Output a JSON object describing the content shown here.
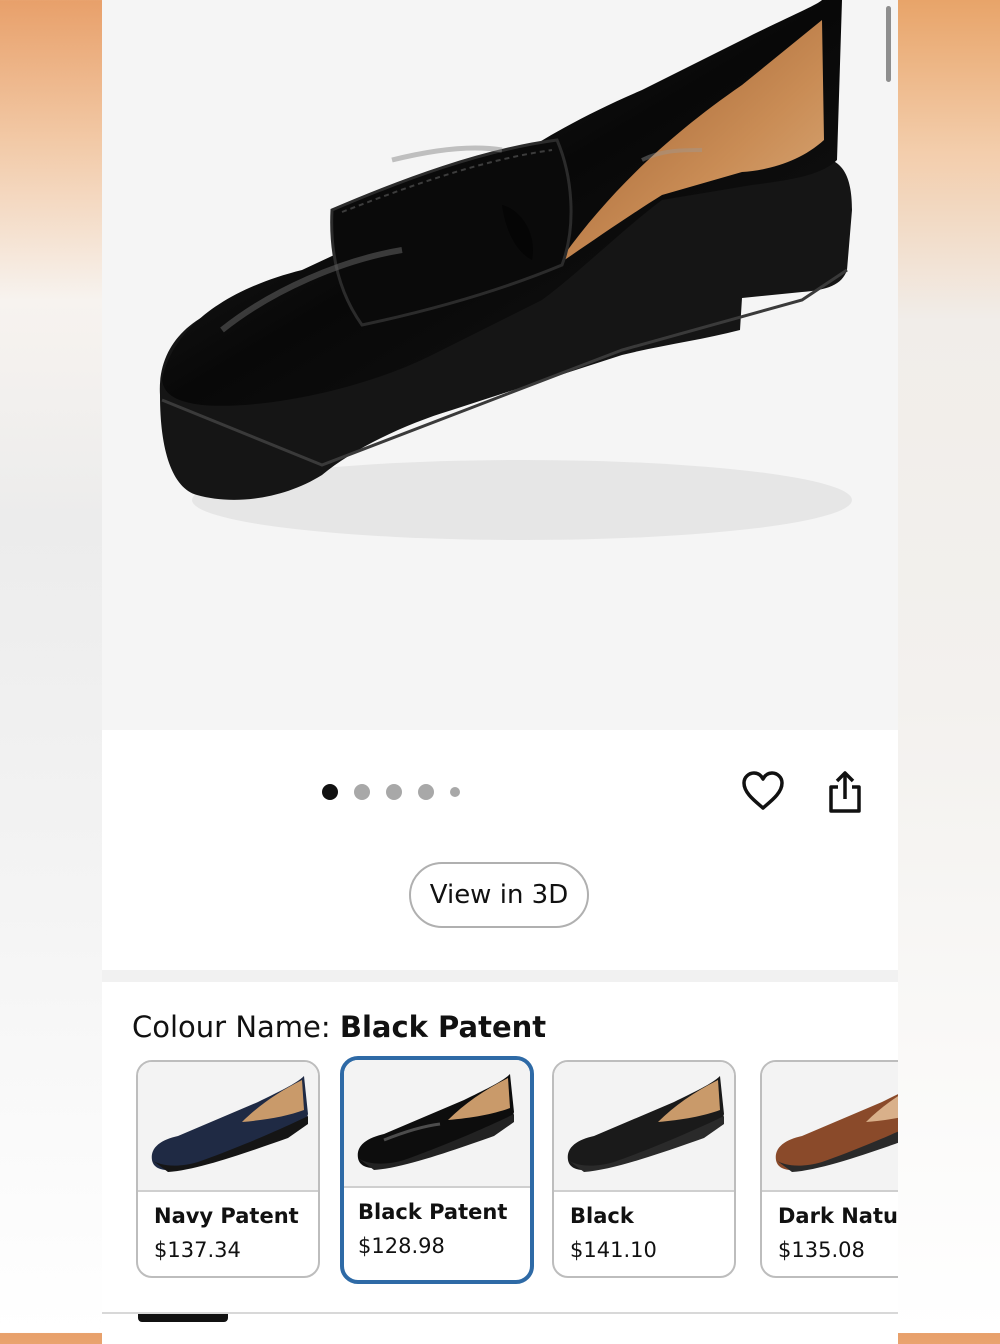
{
  "gallery": {
    "image_alt": "Black patent loafer",
    "dot_count": 5,
    "active_index": 0
  },
  "actions": {
    "wishlist_icon": "heart-icon",
    "share_icon": "share-icon",
    "view_3d_label": "View in 3D"
  },
  "colour": {
    "label": "Colour Name: ",
    "selected_name": "Black Patent",
    "options": [
      {
        "name": "Navy Patent",
        "price": "$137.34",
        "color": "#1f2a44",
        "selected": false
      },
      {
        "name": "Black Patent",
        "price": "$128.98",
        "color": "#0d0d0d",
        "selected": true
      },
      {
        "name": "Black",
        "price": "$141.10",
        "color": "#1a1a1a",
        "selected": false
      },
      {
        "name": "Dark Natur.",
        "price": "$135.08",
        "color": "#8a4a2a",
        "selected": false
      }
    ]
  },
  "colors": {
    "selected_border": "#2e6aa6",
    "active_dot": "#111111",
    "inactive_dot": "#a8a8a8"
  }
}
